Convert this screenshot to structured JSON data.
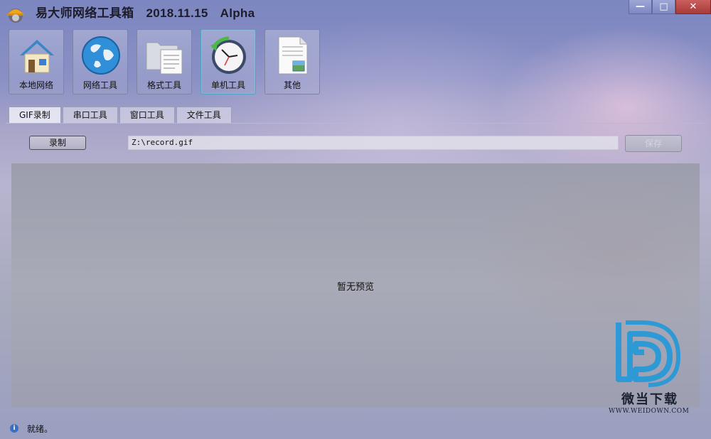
{
  "window": {
    "title": "易大师网络工具箱",
    "date": "2018.11.15",
    "stage": "Alpha",
    "controls": {
      "minimize": "—",
      "maximize": "□",
      "close": "✕"
    }
  },
  "toolbar": {
    "items": [
      {
        "label": "本地网络",
        "icon": "house-icon"
      },
      {
        "label": "网络工具",
        "icon": "globe-icon"
      },
      {
        "label": "格式工具",
        "icon": "folder-document-icon"
      },
      {
        "label": "单机工具",
        "icon": "clock-refresh-icon",
        "active": true
      },
      {
        "label": "其他",
        "icon": "document-image-icon"
      }
    ]
  },
  "tabs": [
    {
      "label": "GIF录制",
      "active": true
    },
    {
      "label": "串口工具"
    },
    {
      "label": "窗口工具"
    },
    {
      "label": "文件工具"
    }
  ],
  "gif": {
    "record_label": "录制",
    "path_value": "Z:\\record.gif",
    "save_label": "保存",
    "save_disabled": true,
    "preview_text": "暂无预览"
  },
  "watermark": {
    "name": "微当下载",
    "url": "WWW.WEIDOWN.COM",
    "color": "#2d9ad6"
  },
  "status": {
    "text": "就绪。",
    "icon": "info-icon"
  }
}
